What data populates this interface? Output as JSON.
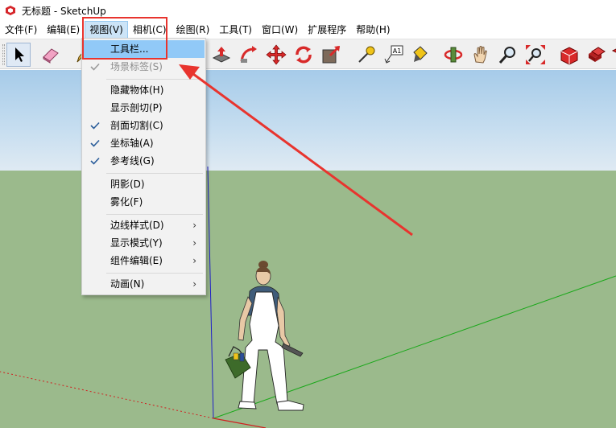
{
  "window": {
    "title": "无标题 - SketchUp"
  },
  "menubar": {
    "items": [
      {
        "label": "文件(F)"
      },
      {
        "label": "编辑(E)"
      },
      {
        "label": "视图(V)"
      },
      {
        "label": "相机(C)"
      },
      {
        "label": "绘图(R)"
      },
      {
        "label": "工具(T)"
      },
      {
        "label": "窗口(W)"
      },
      {
        "label": "扩展程序"
      },
      {
        "label": "帮助(H)"
      }
    ]
  },
  "toolbar": {
    "buttons": [
      {
        "icon": "select-arrow-icon"
      },
      {
        "icon": "eraser-icon"
      },
      {
        "icon": "pencil-icon"
      },
      {
        "icon": "push-pull-icon"
      },
      {
        "icon": "follow-me-icon"
      },
      {
        "icon": "move-icon"
      },
      {
        "icon": "rotate-icon"
      },
      {
        "icon": "scale-icon"
      },
      {
        "icon": "tape-measure-icon"
      },
      {
        "icon": "text-label-icon",
        "text": "A1"
      },
      {
        "icon": "paint-bucket-icon"
      },
      {
        "icon": "orbit-icon"
      },
      {
        "icon": "pan-hand-icon"
      },
      {
        "icon": "zoom-icon"
      },
      {
        "icon": "zoom-extents-icon"
      },
      {
        "icon": "warehouse-icon"
      },
      {
        "icon": "extension-warehouse-icon"
      },
      {
        "icon": "layout-icon"
      }
    ]
  },
  "view_menu": {
    "items": [
      {
        "label": "工具栏...",
        "highlighted": true
      },
      {
        "label": "场景标签(S)",
        "checked": true,
        "disabled": true
      },
      {
        "label": "隐藏物体(H)"
      },
      {
        "label": "显示剖切(P)"
      },
      {
        "label": "剖面切割(C)",
        "checked": true
      },
      {
        "label": "坐标轴(A)",
        "checked": true
      },
      {
        "label": "参考线(G)",
        "checked": true
      },
      {
        "label": "阴影(D)"
      },
      {
        "label": "雾化(F)"
      },
      {
        "label": "边线样式(D)",
        "submenu": true
      },
      {
        "label": "显示模式(Y)",
        "submenu": true
      },
      {
        "label": "组件编辑(E)",
        "submenu": true
      },
      {
        "label": "动画(N)",
        "submenu": true
      }
    ]
  },
  "colors": {
    "sky": "#a6cbe9",
    "ground": "#9bba8c",
    "menu_highlight": "#91c9f7",
    "annotation": "#e8342e",
    "axis_red": "#d02020",
    "axis_green": "#1aa81a",
    "axis_blue": "#2020c8"
  }
}
